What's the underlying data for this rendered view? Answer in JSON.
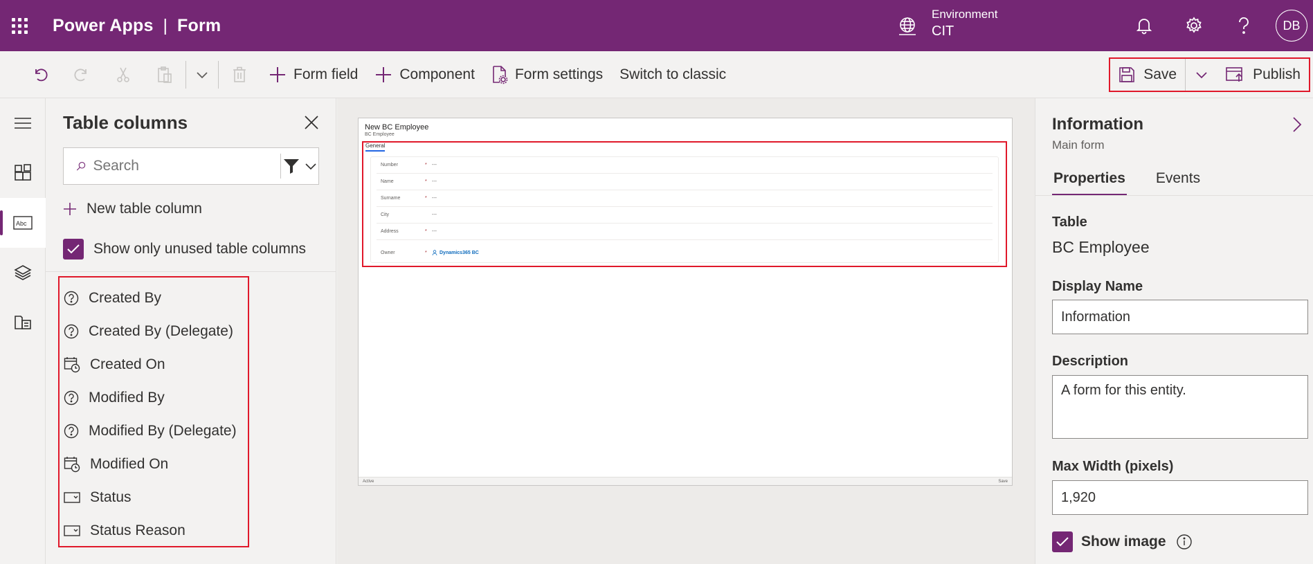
{
  "appbar": {
    "brand": "Power Apps",
    "separator": "|",
    "page": "Form",
    "environment_label": "Environment",
    "environment_value": "CIT",
    "avatar_initials": "DB"
  },
  "toolbar": {
    "form_field": "Form field",
    "component": "Component",
    "form_settings": "Form settings",
    "switch_classic": "Switch to classic",
    "save": "Save",
    "publish": "Publish"
  },
  "pane": {
    "title": "Table columns",
    "search_placeholder": "Search",
    "new_column": "New table column",
    "show_unused": "Show only unused table columns",
    "columns": [
      {
        "label": "Created By",
        "icon": "lookup-icon"
      },
      {
        "label": "Created By (Delegate)",
        "icon": "lookup-icon"
      },
      {
        "label": "Created On",
        "icon": "calendar-icon"
      },
      {
        "label": "Modified By",
        "icon": "lookup-icon"
      },
      {
        "label": "Modified By (Delegate)",
        "icon": "lookup-icon"
      },
      {
        "label": "Modified On",
        "icon": "calendar-icon"
      },
      {
        "label": "Status",
        "icon": "option-set-icon"
      },
      {
        "label": "Status Reason",
        "icon": "option-set-icon"
      }
    ]
  },
  "preview": {
    "title": "New BC Employee",
    "subtitle": "BC Employee",
    "tab": "General",
    "fields": [
      {
        "label": "Number",
        "required": "*",
        "value": "---"
      },
      {
        "label": "Name",
        "required": "*",
        "value": "---"
      },
      {
        "label": "Surname",
        "required": "*",
        "value": "---"
      },
      {
        "label": "City",
        "required": "",
        "value": "---"
      },
      {
        "label": "Address",
        "required": "*",
        "value": "---"
      },
      {
        "label": "Owner",
        "required": "*",
        "value": "Dynamics365 BC"
      }
    ],
    "footer_left": "Active",
    "footer_right": "Save"
  },
  "props": {
    "title": "Information",
    "subtitle": "Main form",
    "tab_properties": "Properties",
    "tab_events": "Events",
    "table_label": "Table",
    "table_value": "BC Employee",
    "display_name_label": "Display Name",
    "display_name_value": "Information",
    "description_label": "Description",
    "description_value": "A form for this entity.",
    "max_width_label": "Max Width (pixels)",
    "max_width_value": "1,920",
    "show_image_label": "Show image"
  },
  "colors": {
    "brand": "#742774",
    "highlight": "#e0182a"
  }
}
